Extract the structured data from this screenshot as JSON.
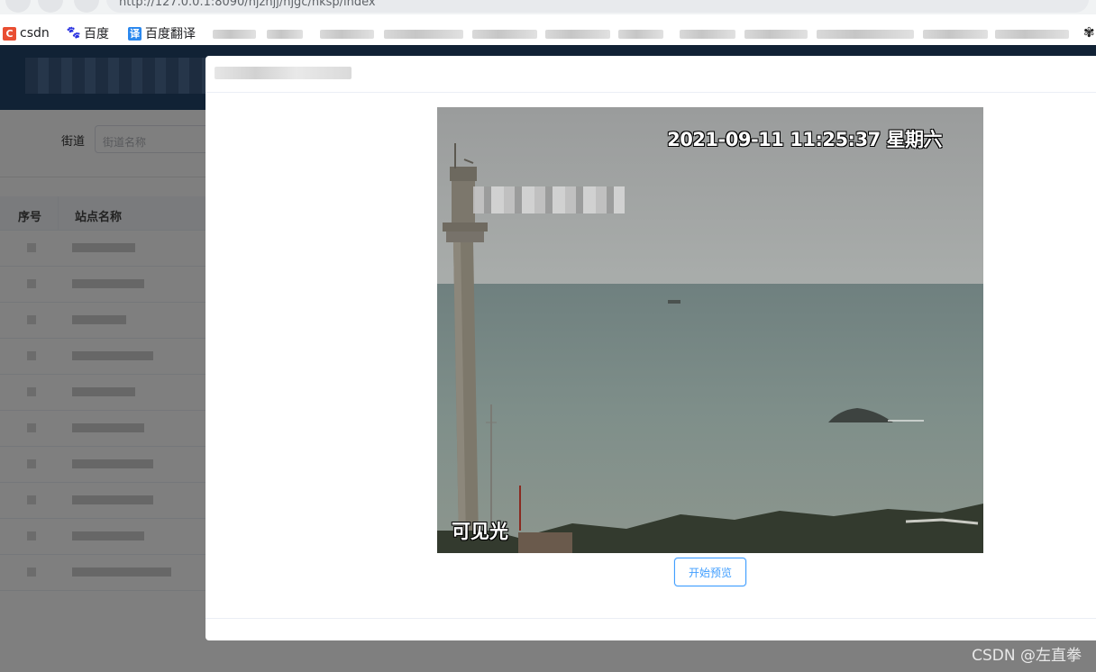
{
  "browser": {
    "url_text": "http://127.0.0.1:8090/hjzhjj/hjgc/hksp/index",
    "bookmarks": [
      {
        "label": "csdn",
        "icon": "csdn-icon",
        "color": "#e94e32"
      },
      {
        "label": "百度",
        "icon": "baidu-paw-icon",
        "color": "#2932e1"
      },
      {
        "label": "百度翻译",
        "icon": "translate-icon",
        "color": "#2b88ee"
      }
    ]
  },
  "background_page": {
    "filter": {
      "label": "街道",
      "placeholder": "街道名称"
    },
    "table": {
      "columns": [
        "序号",
        "站点名称"
      ]
    }
  },
  "dialog": {
    "video": {
      "timestamp": "2021-09-11 11:25:37 星期六",
      "mode_label": "可见光"
    },
    "start_preview_label": "开始预览"
  },
  "watermark": "CSDN @左直拳",
  "colors": {
    "primary": "#409eff",
    "header": "#22446b"
  }
}
